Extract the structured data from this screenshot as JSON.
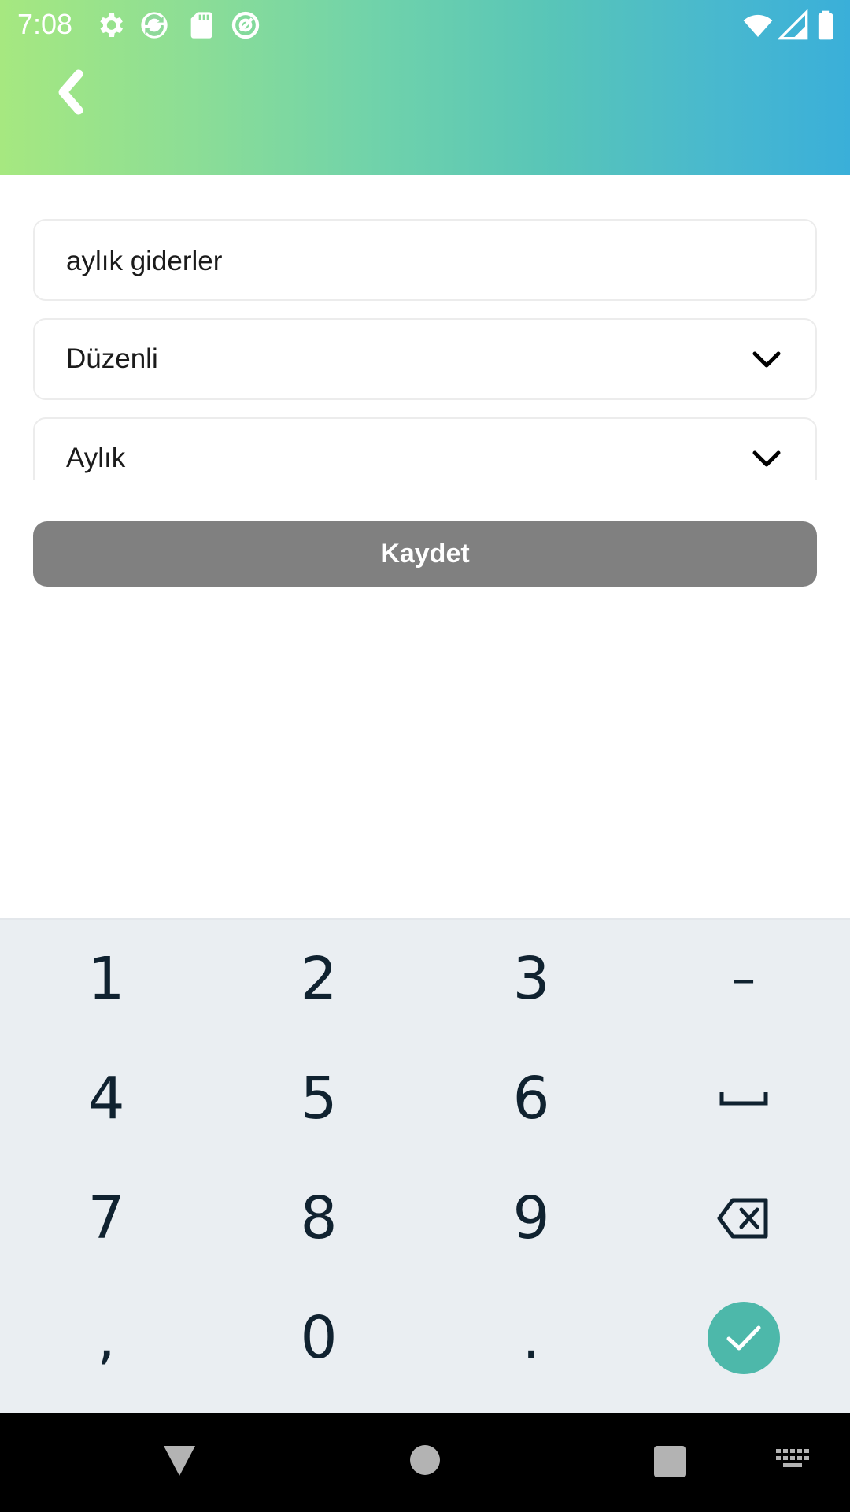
{
  "status_bar": {
    "time": "7:08",
    "icons": [
      "settings-icon",
      "sync-icon",
      "sd-card-icon",
      "at-sign-icon",
      "wifi-icon",
      "cell-signal-icon",
      "battery-icon"
    ]
  },
  "header": {
    "gradient_start": "#a6e880",
    "gradient_end": "#3aafd9",
    "back_icon": "chevron-left-icon"
  },
  "form": {
    "name_value": "aylık giderler",
    "type_select": {
      "selected": "Düzenli"
    },
    "period_select": {
      "selected": "Aylık"
    },
    "save_label": "Kaydet",
    "save_color": "#808080"
  },
  "keyboard": {
    "rows": [
      [
        "1",
        "2",
        "3",
        "–"
      ],
      [
        "4",
        "5",
        "6",
        "space-icon"
      ],
      [
        "7",
        "8",
        "9",
        "backspace-icon"
      ],
      [
        ",",
        "0",
        ".",
        "enter-check-icon"
      ]
    ],
    "enter_color": "#4db8aa"
  },
  "nav_bar": {
    "buttons": [
      "back-triangle-icon",
      "home-circle-icon",
      "recents-square-icon",
      "keyboard-switch-icon"
    ]
  }
}
